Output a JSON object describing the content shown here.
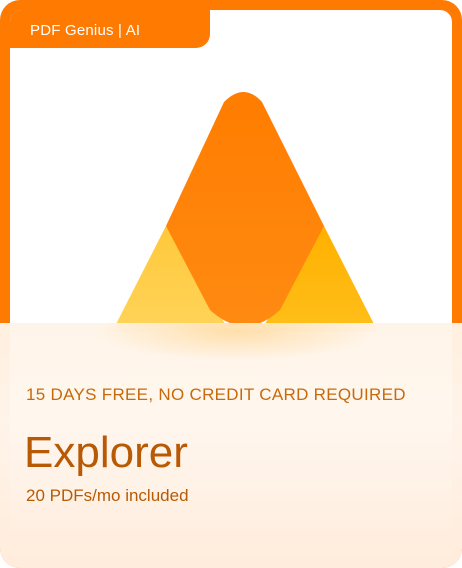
{
  "header": {
    "brand": "PDF Genius | AI"
  },
  "logo": {
    "icon": "stacked-triangles-logo",
    "colors": {
      "main": "#ff7a00",
      "left": "#ffce45",
      "right": "#ffb300"
    }
  },
  "plan": {
    "trial_note": "15 DAYS FREE, NO CREDIT CARD REQUIRED",
    "name": "Explorer",
    "quota": "20 PDFs/mo included"
  },
  "theme": {
    "accent": "#ff7a00",
    "text": "#b85a05"
  }
}
